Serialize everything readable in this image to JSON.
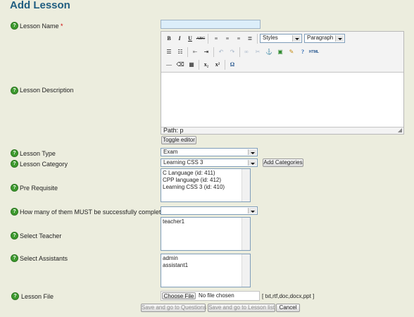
{
  "page_title": "Add Lesson",
  "fields": {
    "lesson_name": {
      "label": "Lesson Name",
      "required_mark": "*",
      "value": ""
    },
    "lesson_description": {
      "label": "Lesson Description"
    },
    "lesson_type": {
      "label": "Lesson Type",
      "selected": "Exam"
    },
    "lesson_category": {
      "label": "Lesson Category",
      "selected": "Learning CSS 3",
      "add_button": "Add Categories"
    },
    "pre_requisite": {
      "label": "Pre Requisite",
      "options": [
        "C Language (id: 411)",
        "CPP language (id: 412)",
        "Learning CSS 3 (id: 410)"
      ]
    },
    "must_complete": {
      "label": "How many of them MUST be successfully completed",
      "selected": ""
    },
    "teacher": {
      "label": "Select Teacher",
      "options": [
        "teacher1"
      ]
    },
    "assistants": {
      "label": "Select Assistants",
      "options": [
        "admin",
        "assistant1"
      ]
    },
    "lesson_file": {
      "label": "Lesson File",
      "choose_button": "Choose File",
      "status": "No file chosen",
      "formats": "[ txt,rtf,doc,docx,ppt ]"
    }
  },
  "editor": {
    "styles_dropdown": "Styles",
    "format_dropdown": "Paragraph",
    "path_text": "Path: p",
    "toggle_button": "Toggle editor",
    "toolbar_row1": [
      "B",
      "I",
      "U",
      "ABC"
    ],
    "html_label": "HTML"
  },
  "actions": {
    "save_questions": "Save and go to Questions",
    "save_list": "Save and go to Lesson list",
    "cancel": "Cancel"
  },
  "colors": {
    "background": "#ecedde",
    "title": "#1f5d80",
    "help_icon": "#3d9a2e",
    "input_highlight": "#dceefa"
  }
}
